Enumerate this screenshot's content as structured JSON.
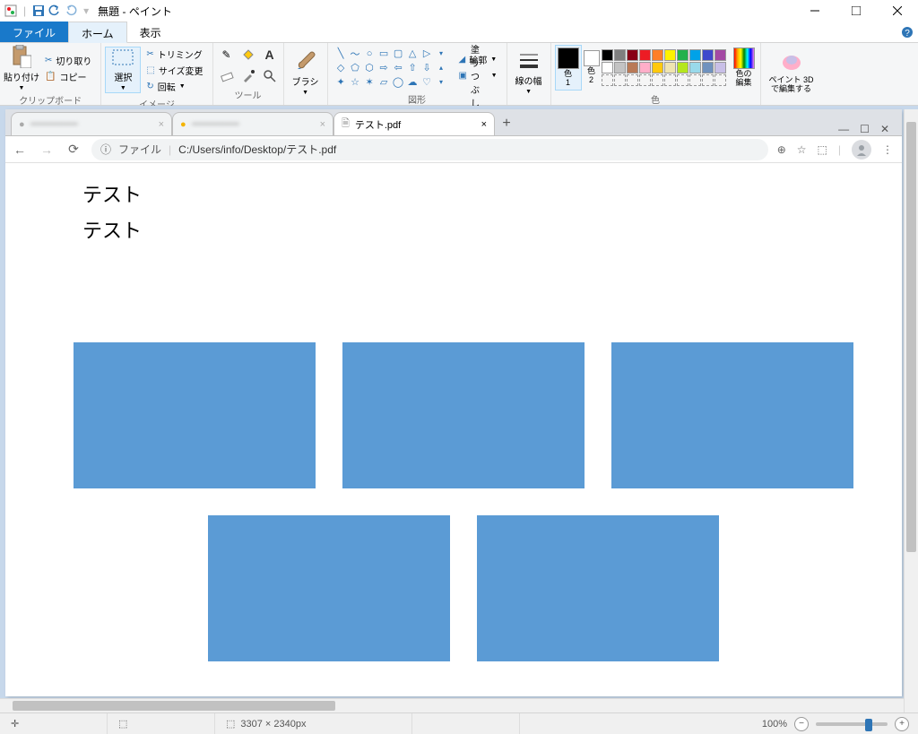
{
  "titlebar": {
    "title": "無題 - ペイント"
  },
  "ribbon": {
    "tabs": {
      "file": "ファイル",
      "home": "ホーム",
      "view": "表示"
    },
    "groups": {
      "clipboard": {
        "paste": "貼り付け",
        "cut": "切り取り",
        "copy": "コピー",
        "label": "クリップボード"
      },
      "image": {
        "select": "選択",
        "crop": "トリミング",
        "resize": "サイズ変更",
        "rotate": "回転",
        "label": "イメージ"
      },
      "tools": {
        "label": "ツール"
      },
      "brushes": {
        "brush": "ブラシ"
      },
      "shapes": {
        "outline": "輪郭",
        "fill": "塗りつぶし",
        "label": "図形"
      },
      "size": {
        "label": "線の幅"
      },
      "colors": {
        "color1_line1": "色",
        "color1_line2": "1",
        "color2_line1": "色",
        "color2_line2": "2",
        "edit_line1": "色の",
        "edit_line2": "編集",
        "label": "色"
      },
      "paint3d": {
        "line1": "ペイント 3D",
        "line2": "で編集する"
      }
    }
  },
  "browser": {
    "tabs": {
      "tab3_title": "テスト.pdf",
      "close": "×",
      "new": "+"
    },
    "url_label": "ファイル",
    "url_sep": "|",
    "url_path": "C:/Users/info/Desktop/テスト.pdf",
    "content": {
      "line1": "テスト",
      "line2": "テスト"
    }
  },
  "statusbar": {
    "cursor_icon": "✛",
    "select_icon": "⬚",
    "size_icon": "⬚",
    "canvas_size": "3307 × 2340px",
    "zoom": "100%",
    "minus": "−",
    "plus": "+"
  },
  "colors": {
    "row1": [
      "#000000",
      "#7f7f7f",
      "#880015",
      "#ed1c24",
      "#ff7f27",
      "#fff200",
      "#22b14c",
      "#00a2e8",
      "#3f48cc",
      "#a349a4"
    ],
    "row2": [
      "#ffffff",
      "#c3c3c3",
      "#b97a57",
      "#ffaec9",
      "#ffc90e",
      "#efe4b0",
      "#b5e61d",
      "#99d9ea",
      "#7092be",
      "#c8bfe7"
    ],
    "row3": [
      "#f5f5f5",
      "#f5f5f5",
      "#f5f5f5",
      "#f5f5f5",
      "#f5f5f5",
      "#f5f5f5",
      "#f5f5f5",
      "#f5f5f5",
      "#f5f5f5",
      "#f5f5f5"
    ]
  }
}
